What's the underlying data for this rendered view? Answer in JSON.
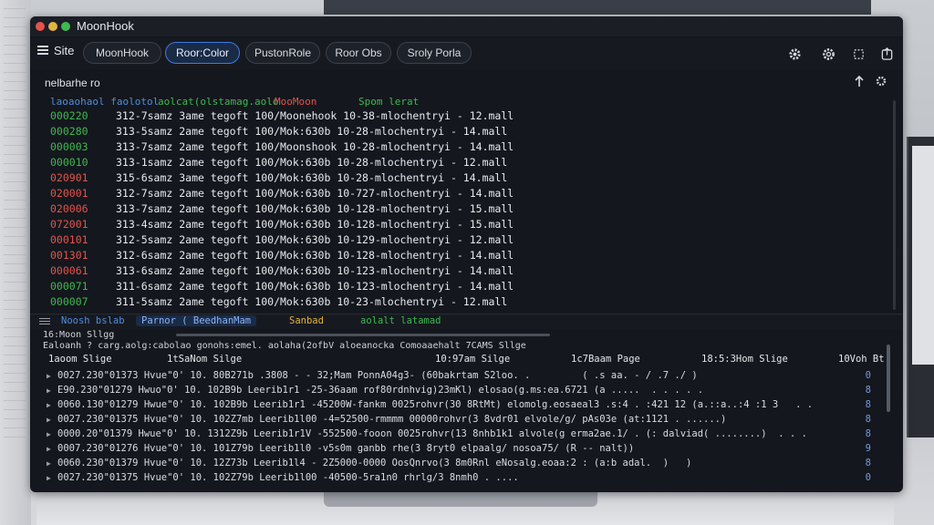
{
  "app": {
    "title": "MoonHook"
  },
  "toolbar": {
    "site_label": "Site",
    "tabs": [
      {
        "label": "MoonHook",
        "active": false
      },
      {
        "label": "Roor:Color",
        "active": true
      },
      {
        "label": "PustonRole",
        "active": false
      },
      {
        "label": "Roor Obs",
        "active": false
      },
      {
        "label": "Sroly Porla",
        "active": false
      }
    ],
    "icons": [
      "gear-icon",
      "settings-icon",
      "crop-icon",
      "share-icon"
    ]
  },
  "log_panel": {
    "title": "nelbarhe ro",
    "header_cols": [
      {
        "label": "laoaohaol faolotol",
        "color": "#4f8ee0"
      },
      {
        "label": "aolcat(olstamag.aolo",
        "color": "#3fb950"
      },
      {
        "label": "MooMoon",
        "color": "#e5534b"
      },
      {
        "label": "Spom lerat",
        "color": "#3fb950"
      }
    ],
    "rows": [
      {
        "id": "000220",
        "color": "#3fb950",
        "text": "312-7samz 3ame tegoft 100/Moonehook 10-38-mlochentryi - 12.mall"
      },
      {
        "id": "000280",
        "color": "#3fb950",
        "text": "313-5samz 2ame tegoft 100/Mok:630b 10-28-mlochentryi - 14.mall"
      },
      {
        "id": "000003",
        "color": "#3fb950",
        "text": "313-7samz 2ame tegoft 100/Moonshook 10-28-mlochentryi - 14.mall"
      },
      {
        "id": "000010",
        "color": "#3fb950",
        "text": "313-1samz 2ame tegoft 100/Mok:630b 10-28-mlochentryi - 12.mall"
      },
      {
        "id": "020901",
        "color": "#e5534b",
        "text": "315-6samz 3ame tegoft 100/Mok:630b 10-28-mlochentryi - 14.mall"
      },
      {
        "id": "020001",
        "color": "#e5534b",
        "text": "312-7samz 2ame tegoft 100/Mok:630b 10-727-mlochentryi - 14.mall"
      },
      {
        "id": "020006",
        "color": "#e5534b",
        "text": "313-7samz 2ame tegoft 100/Mok:630b 10-128-mlochentryi - 15.mall"
      },
      {
        "id": "072001",
        "color": "#e5534b",
        "text": "313-4samz 2ame tegoft 100/Mok:630b 10-128-mlochentryi - 15.mall"
      },
      {
        "id": "000101",
        "color": "#e5534b",
        "text": "312-5samz 2ame tegoft 100/Mok:630b 10-129-mlochentryi - 12.mall"
      },
      {
        "id": "001301",
        "color": "#e5534b",
        "text": "312-6samz 2ame tegoft 100/Mok:630b 10-128-mlochentryi - 14.mall"
      },
      {
        "id": "000061",
        "color": "#e5534b",
        "text": "313-6samz 2ame tegoft 100/Mok:630b 10-123-mlochentryi - 14.mall"
      },
      {
        "id": "000071",
        "color": "#3fb950",
        "text": "311-6samz 2ame tegoft 100/Mok:630b 10-123-mlochentryi - 14.mall"
      },
      {
        "id": "000007",
        "color": "#3fb950",
        "text": "311-5samz 2ame tegoft 100/Mok:630b 10-23-mlochentryi - 12.mall"
      }
    ]
  },
  "divider_tabs": [
    {
      "label": "Noosh bslab",
      "color": "#4f8ee0",
      "active": false
    },
    {
      "label": "Parnor ( BeedhanMam",
      "color": "#8ab4f8",
      "active": true
    },
    {
      "label": "Sanbad",
      "color": "#e3b341",
      "active": false
    },
    {
      "label": "aolalt latamad",
      "color": "#3fb950",
      "active": false
    }
  ],
  "grid": {
    "title": "16:Moon Sllgg",
    "subheader": "Ealoanh ? carg.aolg:cabolao gonohs:emel. aolaha(2ofbV aloeanocka Comoaaehalt 7CAMS Sllge",
    "columns": [
      {
        "label": "1aoom Slige"
      },
      {
        "label": "1tSaNom Silge"
      },
      {
        "label": "10:97am Silge"
      },
      {
        "label": "1c7Baam Page"
      },
      {
        "label": "18:5:3Hom Slige"
      },
      {
        "label": "10Voh Bt"
      }
    ],
    "rows": [
      {
        "text": "0027.230\"01373 Hvue\"0' 10. 80B271b .3808 - - 32;Mam PonnA04g3- (60bakrtam S2loo. .         ( .s aa. - / .7 ./ )",
        "n": "0"
      },
      {
        "text": "E90.230\"01279 Hwuo\"0' 10. 102B9b Leerib1r1 -25-36aam rof80rdnhvig)23mKl) elosao(g.ms:ea.6721 (a .....  . . . . .",
        "n": "8"
      },
      {
        "text": "0060.130\"01279 Hwue\"0' 10. 102B9b Leerib1r1 -45200W-fankm 0025rohvr(30 8RtMt) elomolg.eosaeal3 .s:4 . :421 12 (a.::a..:4 :1 3   . .",
        "n": "8"
      },
      {
        "text": "0027.230\"01375 Hvue\"0' 10. 102Z7mb Leerib1l00 -4=52500-rmmmm 00000rohvr(3 8vdr01 elvole/g/ pAs03e (at:1121 . ......)",
        "n": "8"
      },
      {
        "text": "0000.20\"01379 Hwue\"0' 10. 1312Z9b Leerib1r1V -552500-fooon 0025rohvr(13 8nhb1k1 alvole(g erma2ae.1/ . (: dalviad( ........)  . . .",
        "n": "8"
      },
      {
        "text": "0007.230\"01276 Hvue\"0' 10. 101Z79b Leerib1l0 -v5s0m ganbb rhe(3 8ryt0 elpaalg/ nosoa75/ (R -- nalt))",
        "n": "9"
      },
      {
        "text": "0060.230\"01379 Hvue\"0' 10. 12Z73b Leerib1l4 - 2Z5000-0000 OosQnrvo(3 8m0Rnl eNosalg.eoaa:2 : (a:b adal.  )   )",
        "n": "8"
      },
      {
        "text": "0027.230\"01375 Hvue\"0' 10. 102Z79b Leerib1l00 -40500-5ra1n0 rhrlg/3 8nmh0 . ....",
        "n": "0"
      }
    ]
  }
}
